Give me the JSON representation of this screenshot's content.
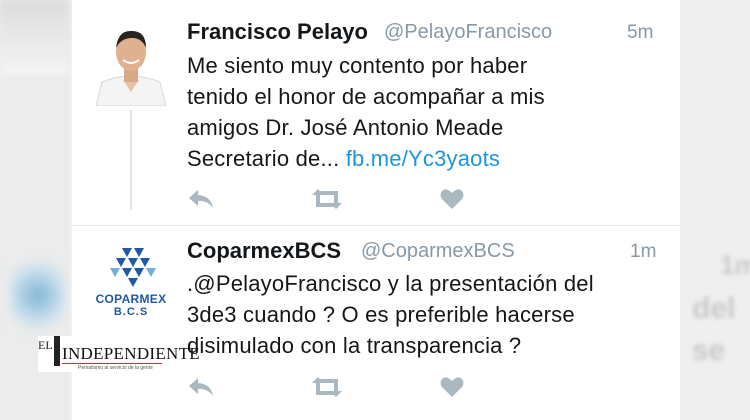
{
  "tweets": [
    {
      "name": "Francisco Pelayo",
      "handle": "@PelayoFrancisco",
      "time": "5m",
      "text": "Me siento muy contento por haber\ntenido el honor de acompañar a mis\namigos Dr. José Antonio Meade\nSecretario de... ",
      "link": "fb.me/Yc3yaots"
    },
    {
      "name": "CoparmexBCS",
      "handle": "@CoparmexBCS",
      "time": "1m",
      "text": ".@PelayoFrancisco y la presentación del\n3de3 cuando ? O es preferible hacerse\ndisimulado con la transparencia ?",
      "avatar_logo": "COPARMEX",
      "avatar_sub": "B.C.S"
    }
  ],
  "background_right": [
    "1m",
    "del",
    "se"
  ],
  "watermark": {
    "el": "EL",
    "brand": "INDEPENDIENTE",
    "tagline": "Periodismo al servicio de la gente"
  },
  "colors": {
    "link": "#1b95e0",
    "muted": "#8899a6",
    "icon": "#aab8c2",
    "coparmex_blue": "#1f5aa6"
  },
  "icons": [
    "reply-icon",
    "retweet-icon",
    "like-icon"
  ]
}
